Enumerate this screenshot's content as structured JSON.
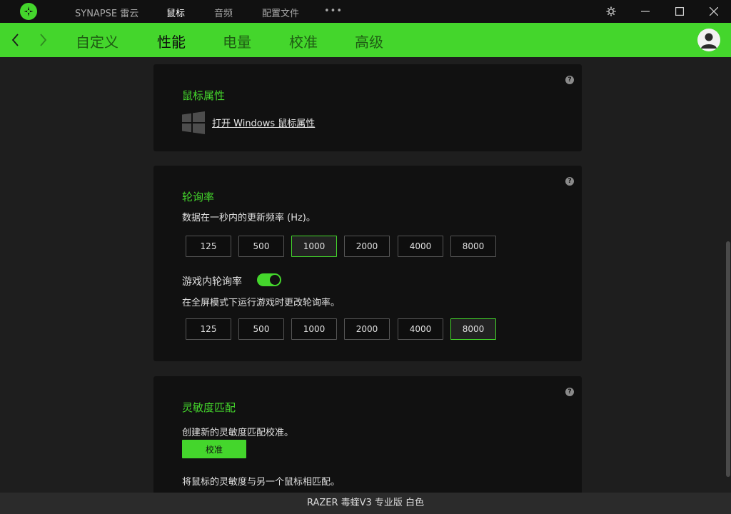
{
  "titlebar": {
    "nav": [
      {
        "label": "SYNAPSE 雷云",
        "active": false
      },
      {
        "label": "鼠标",
        "active": true
      },
      {
        "label": "音频",
        "active": false
      },
      {
        "label": "配置文件",
        "active": false
      }
    ],
    "more": "•••"
  },
  "tabs": [
    {
      "label": "自定义",
      "active": false
    },
    {
      "label": "性能",
      "active": true
    },
    {
      "label": "电量",
      "active": false
    },
    {
      "label": "校准",
      "active": false
    },
    {
      "label": "高级",
      "active": false
    }
  ],
  "mouse_props": {
    "title": "鼠标属性",
    "link": "打开 Windows 鼠标属性"
  },
  "polling": {
    "title": "轮询率",
    "desc": "数据在一秒内的更新频率 (Hz)。",
    "rates": [
      "125",
      "500",
      "1000",
      "2000",
      "4000",
      "8000"
    ],
    "selected": "1000",
    "ingame_label": "游戏内轮询率",
    "ingame_enabled": true,
    "ingame_desc": "在全屏模式下运行游戏时更改轮询率。",
    "ingame_rates": [
      "125",
      "500",
      "1000",
      "2000",
      "4000",
      "8000"
    ],
    "ingame_selected": "8000"
  },
  "sensitivity": {
    "title": "灵敏度匹配",
    "desc": "创建新的灵敏度匹配校准。",
    "button": "校准",
    "desc2": "将鼠标的灵敏度与另一个鼠标相匹配。"
  },
  "help": "?",
  "status": "RAZER 毒蝰V3 专业版 白色",
  "colors": {
    "accent": "#44d62c",
    "background": "#1e1e1e",
    "card": "#111111"
  }
}
